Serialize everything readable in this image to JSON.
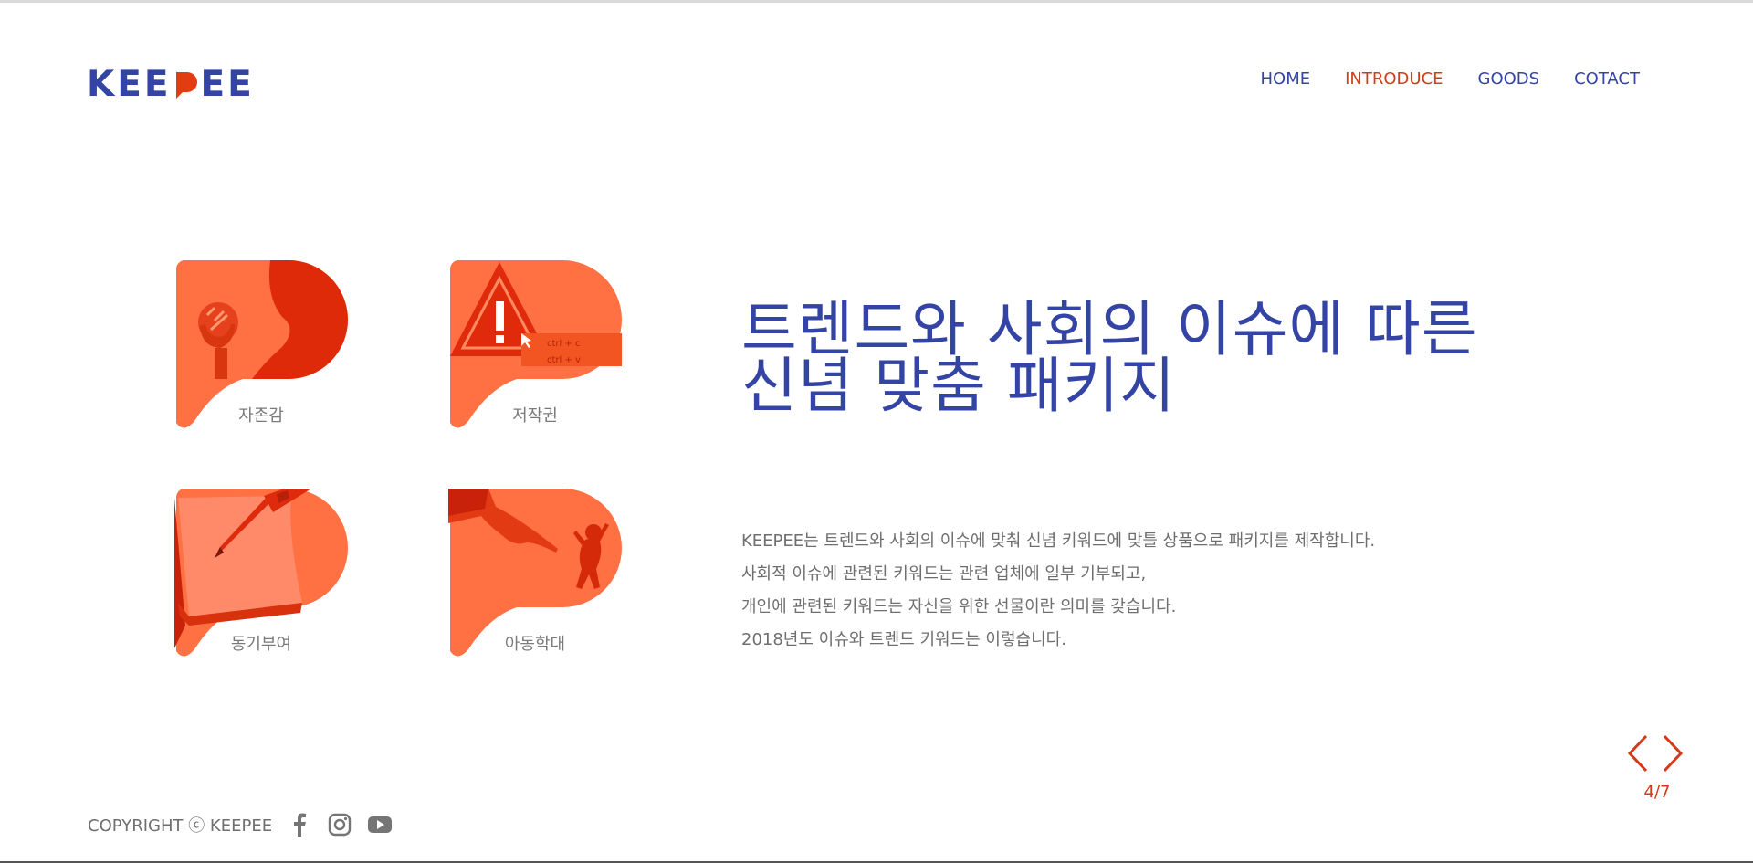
{
  "header": {
    "logo_text_left": "KEE",
    "logo_text_right": "EE",
    "logo_alt": "KEEPEE",
    "nav": [
      {
        "label": "HOME",
        "active": false
      },
      {
        "label": "INTRODUCE",
        "active": true
      },
      {
        "label": "GOODS",
        "active": false
      },
      {
        "label": "COTACT",
        "active": false
      }
    ]
  },
  "cards": [
    {
      "label": "자존감",
      "icon": "self-esteem-hand-heart-icon"
    },
    {
      "label": "저작권",
      "icon": "copyright-warning-ctrl-icon"
    },
    {
      "label": "동기부여",
      "icon": "motivation-pen-paper-icon"
    },
    {
      "label": "아동학대",
      "icon": "child-abuse-pointing-hand-icon"
    }
  ],
  "card_overlay_text": {
    "ctrl_c": "ctrl + c",
    "ctrl_v": "ctrl + v"
  },
  "headline": {
    "line1": "트렌드와 사회의 이슈에 따른",
    "line2": "신념 맞춤 패키지"
  },
  "description": [
    "KEEPEE는 트렌드와 사회의 이슈에 맞춰 신념 키워드에 맞틀 상품으로 패키지를 제작합니다.",
    "사회적 이슈에 관련된 키워드는 관련 업체에 일부 기부되고,",
    "개인에 관련된 키워드는 자신을 위한 선물이란 의미를 갖습니다.",
    "2018년도 이슈와 트렌드 키워드는 이렇습니다."
  ],
  "slider": {
    "counter": "4/7",
    "prev_icon": "chevron-left-icon",
    "next_icon": "chevron-right-icon"
  },
  "footer": {
    "copyright": "COPYRIGHT ⓒ KEEPEE",
    "social": [
      "facebook-icon",
      "instagram-icon",
      "youtube-icon"
    ]
  },
  "colors": {
    "brand_blue": "#3444a4",
    "accent_red": "#d33a1a",
    "card_orange": "#ff7043",
    "card_deep": "#e02a0c"
  }
}
